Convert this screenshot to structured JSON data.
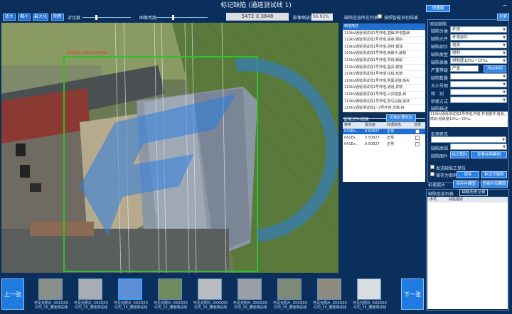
{
  "window": {
    "title": "标记缺陷 (通道测试线 1)"
  },
  "toolbar": {
    "zoom_in": "放大",
    "zoom_out": "缩小",
    "fit": "最大化",
    "full": "刷新",
    "contrast_label": "对比度",
    "brightness_label": "图像亮度",
    "dimensions": "5472 X 3648",
    "zoom_label": "影像缩放比",
    "zoom_value": "96.92%"
  },
  "image": {
    "annotation_text": "Defect Select Area"
  },
  "defect_list": {
    "header_label": "缺陷信息所在列表",
    "smart_check_label": "按照智能识别结果",
    "title": "缺陷描述",
    "rows": [
      "110kV通道测试线1号杆塔,基础,杆塔基础",
      "110kV通道测试线1号杆塔,塔身,倾斜",
      "110kV通道测试线1号杆塔,塔材,锈蚀",
      "110kV通道测试线1号杆塔,绝缘子,破损",
      "110kV通道测试线1号杆塔,导线,断股",
      "110kV通道测试线1号杆塔,金具,锈蚀",
      "110kV通道测试线1号杆塔,拉线,松弛",
      "110kV通道测试线1号杆塔,附属设施,缺失",
      "110kV通道测试线1号杆塔,通道,异物",
      "110kV通道测试线1号杆塔,火灾隐患,树",
      "110kV通道测试线1号杆塔,防鸟设施,损坏",
      "110kV通道测试线1~2号杆塔,交跨,树",
      "110kV通道测试线1~2号杆塔,交跨,建筑"
    ]
  },
  "side_buttons": {
    "quick_btn": "快捷键",
    "all_btn": "全屏"
  },
  "form": {
    "add_defect_label": "添加缺陷",
    "category_label": "缺陷分类",
    "category_value": "杆塔",
    "part_label": "缺陷元件",
    "part_value": "杆塔部件",
    "position_label": "缺陷部位",
    "position_value": "塔身",
    "type_label": "缺陷类型",
    "type_value": "倾斜",
    "desc_label": "缺陷表象",
    "desc_value": "倾斜度10‰~15‰",
    "severity_label": "严重等级",
    "severity_value": "严重",
    "add_common_btn": "添加常用",
    "quantity_label": "缺陷数量",
    "size_label": "大小号侧",
    "phase_label": "相　别",
    "check_label": "检修方式",
    "desc_title": "缺陷描述",
    "desc_text": "110kV通道测试线1号杆塔,杆塔,杆塔部件,塔身,倾斜,倾斜度10‰~15‰"
  },
  "smart": {
    "title": "智能识别结果",
    "toggle_btn": "切换处理状态",
    "columns": [
      "种类",
      "置信度",
      "处理状态",
      "选择"
    ],
    "rows": [
      {
        "kind": "041Ex...",
        "conf": "0.50827",
        "state": "正常",
        "selected": true
      },
      {
        "kind": "041Ex...",
        "conf": "0.50827",
        "state": "正常",
        "selected": false
      },
      {
        "kind": "041Ex...",
        "conf": "0.50827",
        "state": "正常",
        "selected": false
      }
    ]
  },
  "lower_form": {
    "handle_label": "处理意见",
    "repair_label": "缺陷原因",
    "mark_label": "缺陷图片",
    "mark_btn": "标记图片",
    "view_btn": "查看经典案例",
    "unit_check": "发送缺陷工单位",
    "save_check": "保存为案例",
    "save_btn": "保存",
    "mark_none_btn": "标记无缺陷",
    "nav_label": "杆塔照片",
    "save_send_btn": "保存并翻图",
    "view_all_btn": "查看所有翻图"
  },
  "history": {
    "title": "缺陷信息列表",
    "tab": "缺陷历史记录",
    "col1": "序号",
    "col2": "缺陷描述"
  },
  "thumbs": {
    "prev": "上一张",
    "next": "下一张",
    "items": [
      "可见光照片_XXXXXX公司_15_通道测试线",
      "可见光照片_XXXXXX公司_15_通道测试线",
      "可见光照片_XXXXXX公司_15_通道测试线",
      "可见光照片_XXXXXX公司_15_通道测试线",
      "可见光照片_XXXXXX公司_15_通道测试线",
      "可见光照片_XXXXXX公司_15_通道测试线",
      "可见光照片_XXXXXX公司_15_通道测试线",
      "可见光照片_XXXXXX公司_15_通道测试线",
      "可见光照片_XXXXXX公司_15_通道测试线"
    ]
  }
}
